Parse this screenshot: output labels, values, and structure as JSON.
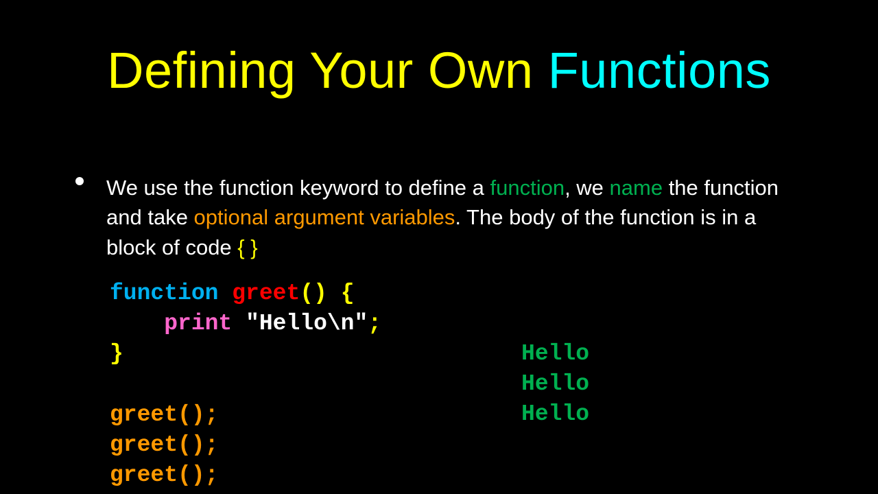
{
  "title": {
    "part1": "Defining Your Own ",
    "part2": "Functions"
  },
  "para": {
    "t1": "We use the function keyword to define a ",
    "t2": "function",
    "t3": ", we ",
    "t4": "name",
    "t5": " the function and take ",
    "t6": "optional argument variables",
    "t7": ".  The body of the function is in a block of code ",
    "t8": "{ }"
  },
  "code": {
    "kw": "function",
    "sp1": " ",
    "fn": "greet",
    "parens": "()",
    "sp2": " ",
    "brace_open": "{",
    "indent": "    ",
    "print": "print",
    "sp3": " ",
    "string": "\"Hello\\n\"",
    "semi": ";",
    "brace_close": "}",
    "call": "greet();"
  },
  "output": {
    "line": "Hello"
  }
}
